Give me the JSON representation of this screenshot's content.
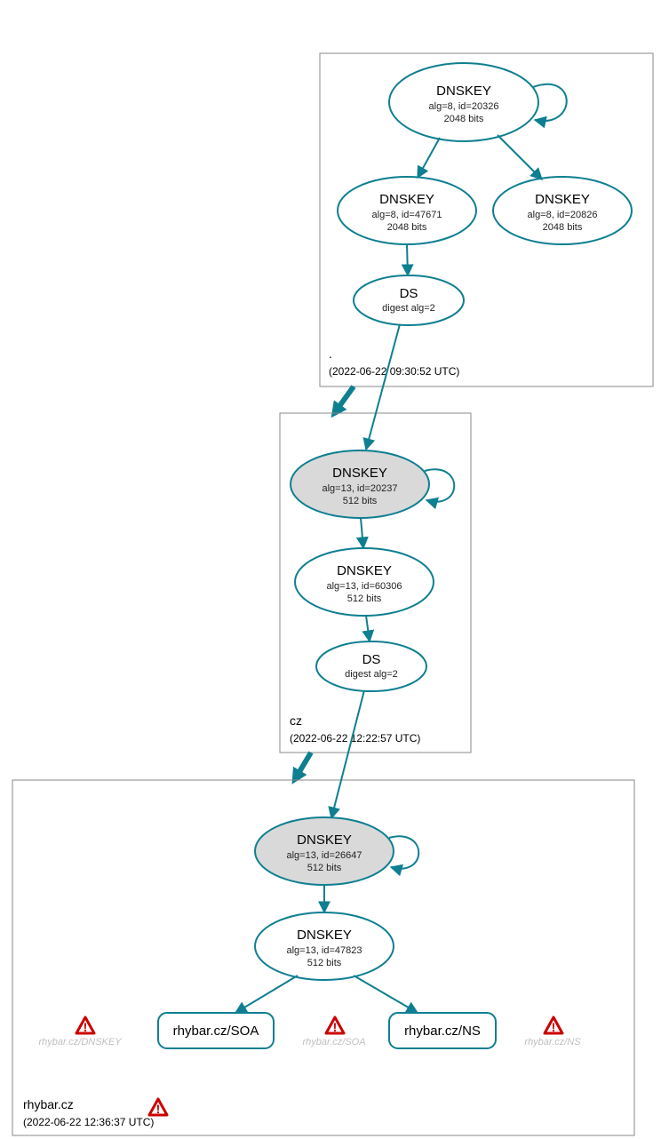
{
  "zones": {
    "root": {
      "label": ".",
      "timestamp": "(2022-06-22 09:30:52 UTC)",
      "nodes": {
        "ksk": {
          "title": "DNSKEY",
          "sub1": "alg=8, id=20326",
          "sub2": "2048 bits"
        },
        "zsk1": {
          "title": "DNSKEY",
          "sub1": "alg=8, id=47671",
          "sub2": "2048 bits"
        },
        "zsk2": {
          "title": "DNSKEY",
          "sub1": "alg=8, id=20826",
          "sub2": "2048 bits"
        },
        "ds": {
          "title": "DS",
          "sub1": "digest alg=2"
        }
      }
    },
    "cz": {
      "label": "cz",
      "timestamp": "(2022-06-22 12:22:57 UTC)",
      "nodes": {
        "ksk": {
          "title": "DNSKEY",
          "sub1": "alg=13, id=20237",
          "sub2": "512 bits"
        },
        "zsk": {
          "title": "DNSKEY",
          "sub1": "alg=13, id=60306",
          "sub2": "512 bits"
        },
        "ds": {
          "title": "DS",
          "sub1": "digest alg=2"
        }
      }
    },
    "rhybar": {
      "label": "rhybar.cz",
      "timestamp": "(2022-06-22 12:36:37 UTC)",
      "nodes": {
        "ksk": {
          "title": "DNSKEY",
          "sub1": "alg=13, id=26647",
          "sub2": "512 bits"
        },
        "zsk": {
          "title": "DNSKEY",
          "sub1": "alg=13, id=47823",
          "sub2": "512 bits"
        },
        "soa": {
          "title": "rhybar.cz/SOA"
        },
        "ns": {
          "title": "rhybar.cz/NS"
        }
      },
      "ghosts": {
        "dnskey": "rhybar.cz/DNSKEY",
        "soa": "rhybar.cz/SOA",
        "ns": "rhybar.cz/NS"
      }
    }
  }
}
